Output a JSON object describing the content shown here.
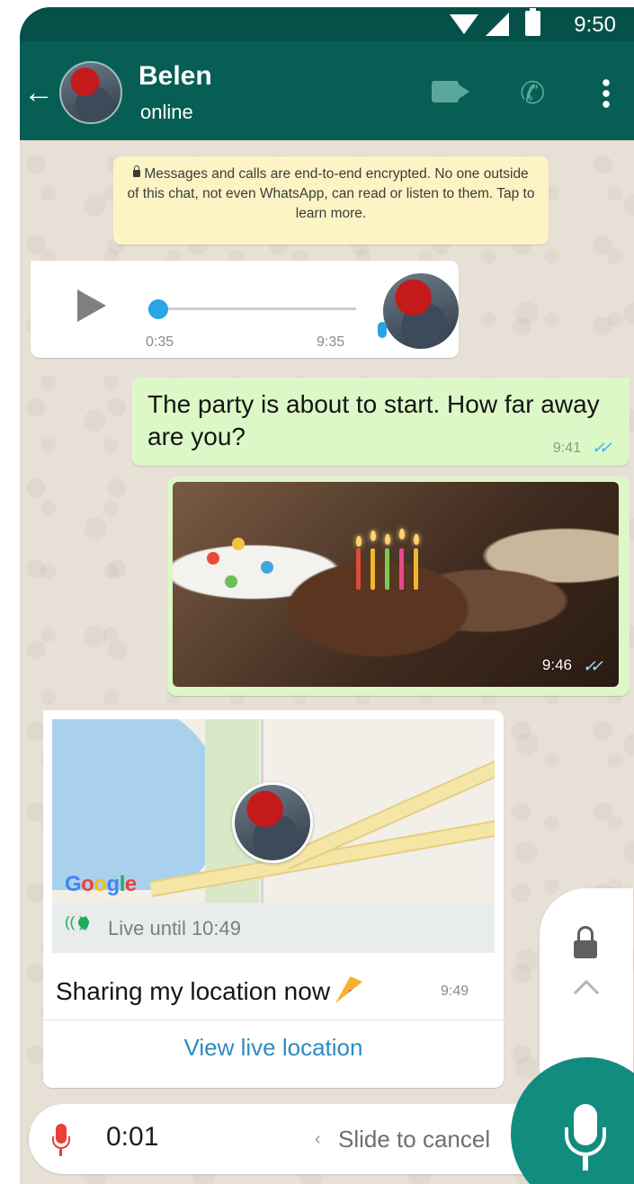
{
  "status_bar": {
    "time": "9:50"
  },
  "header": {
    "contact_name": "Belen",
    "contact_status": "online",
    "back_icon": "arrow-left-icon",
    "video_icon": "video-call-icon",
    "call_icon": "phone-icon",
    "menu_icon": "more-vert-icon"
  },
  "encryption_notice": {
    "text": "Messages and calls are end-to-end encrypted. No one outside of this chat, not even WhatsApp, can read or listen to them. Tap to learn more."
  },
  "messages": {
    "voice": {
      "duration": "0:35",
      "time": "9:35",
      "progress": 0.02
    },
    "text": {
      "body": "The party is about to start. How far away are you?",
      "time": "9:41",
      "ticks": "✓✓"
    },
    "photo": {
      "time": "9:46",
      "ticks": "✓✓"
    },
    "location": {
      "map_brand": "Google",
      "live_until": "Live until 10:49",
      "caption": "Sharing my location now",
      "time": "9:49",
      "action": "View live location"
    }
  },
  "recording": {
    "elapsed": "0:01",
    "hint_chevron": "‹",
    "hint": "Slide to cancel"
  },
  "colors": {
    "header": "#075e54",
    "status_bar": "#05514a",
    "out_bubble": "#dcf8c6",
    "fab": "#128c7e",
    "link": "#2e8bc4",
    "ticks": "#34b7f1",
    "record_mic": "#ea3e37"
  }
}
